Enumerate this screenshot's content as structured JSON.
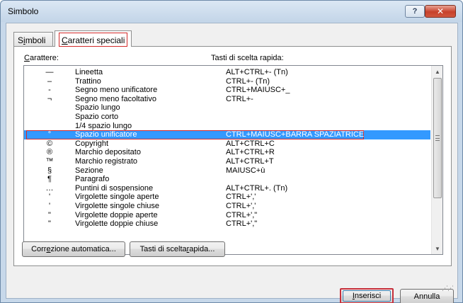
{
  "window": {
    "title": "Simbolo",
    "help_label": "?",
    "close_label": "✕"
  },
  "tabs": [
    {
      "label": "Simboli",
      "underline": "i",
      "rest": "mboli",
      "pre": "S"
    },
    {
      "label": "Caratteri speciali",
      "pre": "",
      "underline": "C",
      "rest": "aratteri speciali"
    }
  ],
  "headers": {
    "character": "Carattere:",
    "character_u": "C",
    "character_rest": "arattere:",
    "shortcut": "Tasti di scelta rapida:"
  },
  "rows": [
    {
      "char": "—",
      "name": "Lineetta",
      "keys": "ALT+CTRL+- (Tn)"
    },
    {
      "char": "–",
      "name": "Trattino",
      "keys": "CTRL+- (Tn)"
    },
    {
      "char": "-",
      "name": "Segno meno unificatore",
      "keys": "CTRL+MAIUSC+_"
    },
    {
      "char": "¬",
      "name": "Segno meno facoltativo",
      "keys": "CTRL+-"
    },
    {
      "char": "",
      "name": "Spazio lungo",
      "keys": ""
    },
    {
      "char": "",
      "name": "Spazio corto",
      "keys": ""
    },
    {
      "char": "",
      "name": "1/4  spazio lungo",
      "keys": ""
    },
    {
      "char": "°",
      "name": "Spazio unificatore",
      "keys": "CTRL+MAIUSC+BARRA SPAZIATRICE",
      "selected": true
    },
    {
      "char": "©",
      "name": "Copyright",
      "keys": "ALT+CTRL+C"
    },
    {
      "char": "®",
      "name": "Marchio depositato",
      "keys": "ALT+CTRL+R"
    },
    {
      "char": "™",
      "name": "Marchio registrato",
      "keys": "ALT+CTRL+T"
    },
    {
      "char": "§",
      "name": "Sezione",
      "keys": "MAIUSC+ù"
    },
    {
      "char": "¶",
      "name": "Paragrafo",
      "keys": ""
    },
    {
      "char": "…",
      "name": "Puntini di sospensione",
      "keys": "ALT+CTRL+. (Tn)"
    },
    {
      "char": "'",
      "name": "Virgolette singole aperte",
      "keys": "CTRL+',' "
    },
    {
      "char": "'",
      "name": "Virgolette singole chiuse",
      "keys": "CTRL+','"
    },
    {
      "char": "\"",
      "name": "Virgolette doppie aperte",
      "keys": "CTRL+',\""
    },
    {
      "char": "\"",
      "name": "Virgolette doppie chiuse",
      "keys": "CTRL+',\""
    }
  ],
  "buttons": {
    "autocorrect_pre": "Corr",
    "autocorrect_u": "e",
    "autocorrect_rest": "zione automatica...",
    "shortcut_pre": "Tasti di scelta ",
    "shortcut_u": "r",
    "shortcut_rest": "apida...",
    "insert_u": "I",
    "insert_rest": "nserisci",
    "cancel": "Annulla"
  },
  "colors": {
    "selection": "#3399ff",
    "focus_outline": "#d22a2a"
  }
}
